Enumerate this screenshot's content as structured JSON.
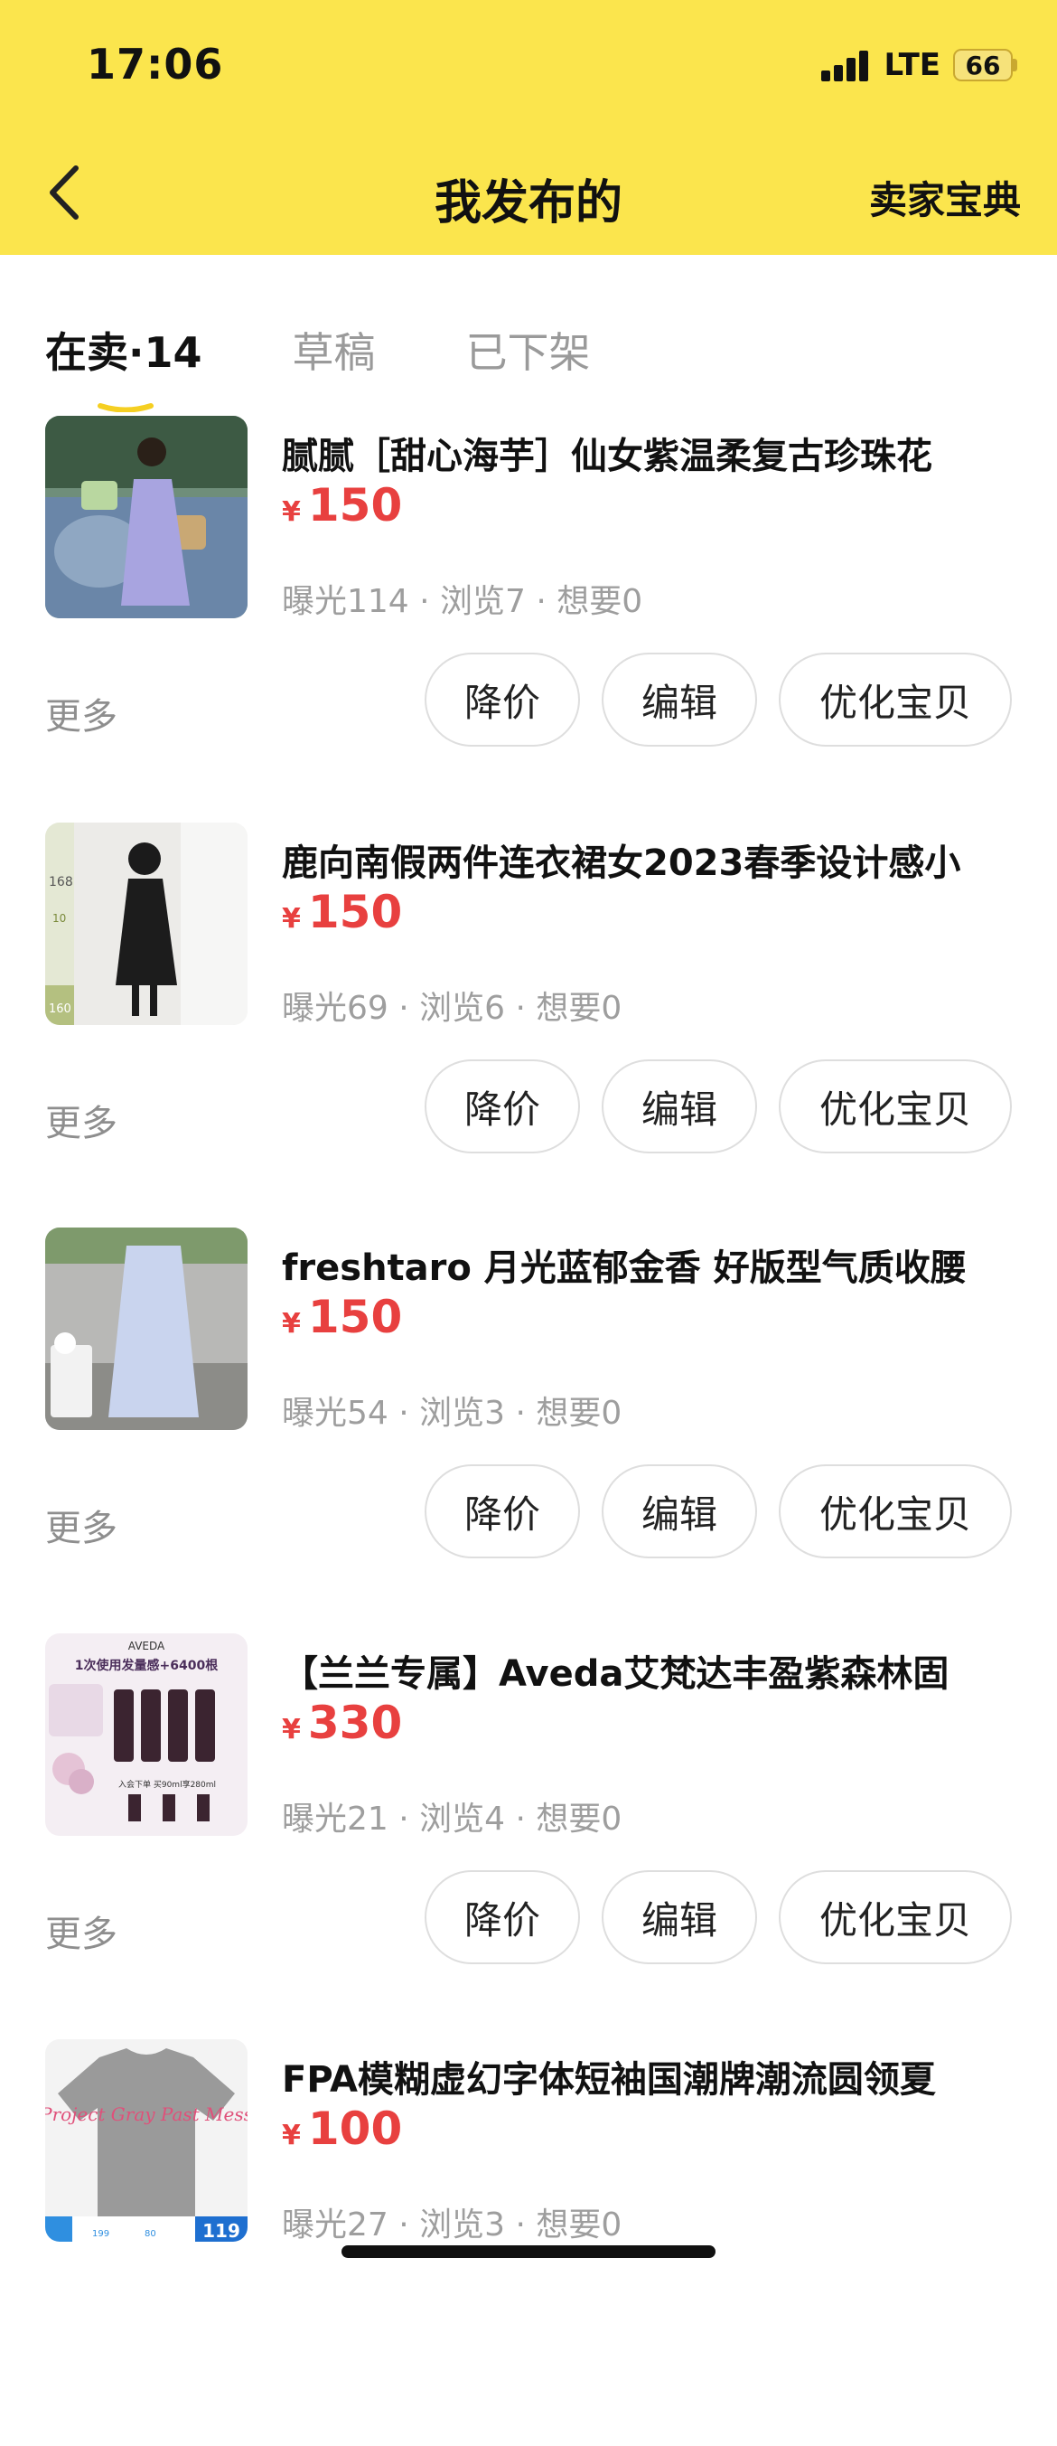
{
  "status_bar": {
    "time": "17:06",
    "network": "LTE",
    "battery": "66"
  },
  "nav": {
    "title": "我发布的",
    "right_link": "卖家宝典"
  },
  "tabs": [
    {
      "label": "在卖·14",
      "active": true
    },
    {
      "label": "草稿",
      "active": false
    },
    {
      "label": "已下架",
      "active": false
    }
  ],
  "items": [
    {
      "title": "腻腻［甜心海芋］仙女紫温柔复古珍珠花",
      "currency": "¥",
      "price": "150",
      "stats": "曝光114 · 浏览7 · 想要0"
    },
    {
      "title": "鹿向南假两件连衣裙女2023春季设计感小",
      "currency": "¥",
      "price": "150",
      "stats": "曝光69 · 浏览6 · 想要0"
    },
    {
      "title": "freshtaro 月光蓝郁金香 好版型气质收腰",
      "currency": "¥",
      "price": "150",
      "stats": "曝光54 · 浏览3 · 想要0"
    },
    {
      "title": "【兰兰专属】Aveda艾梵达丰盈紫森林固",
      "currency": "¥",
      "price": "330",
      "stats": "曝光21 · 浏览4 · 想要0"
    },
    {
      "title": "FPA模糊虚幻字体短袖国潮牌潮流圆领夏",
      "currency": "¥",
      "price": "100",
      "stats": "曝光27 · 浏览3 · 想要0"
    }
  ],
  "actions": {
    "more": "更多",
    "reduce_price": "降价",
    "edit": "编辑",
    "optimize": "优化宝贝"
  },
  "thumb_texts": {
    "item2_marks": [
      "168",
      "10",
      "160"
    ],
    "item4_brand": "AVEDA",
    "item4_headline": "1次使用发量感+6400根",
    "item4_offer": "入会下单 买90ml享280ml",
    "item5_print": "Project Gray Past Mess",
    "item5_price": "119",
    "item5_prices": [
      "199",
      "80"
    ]
  },
  "colors": {
    "header_bg": "#fbe54d",
    "price": "#e8403f",
    "muted": "#9e9e9e",
    "tab_underline": "#f5cf22"
  }
}
